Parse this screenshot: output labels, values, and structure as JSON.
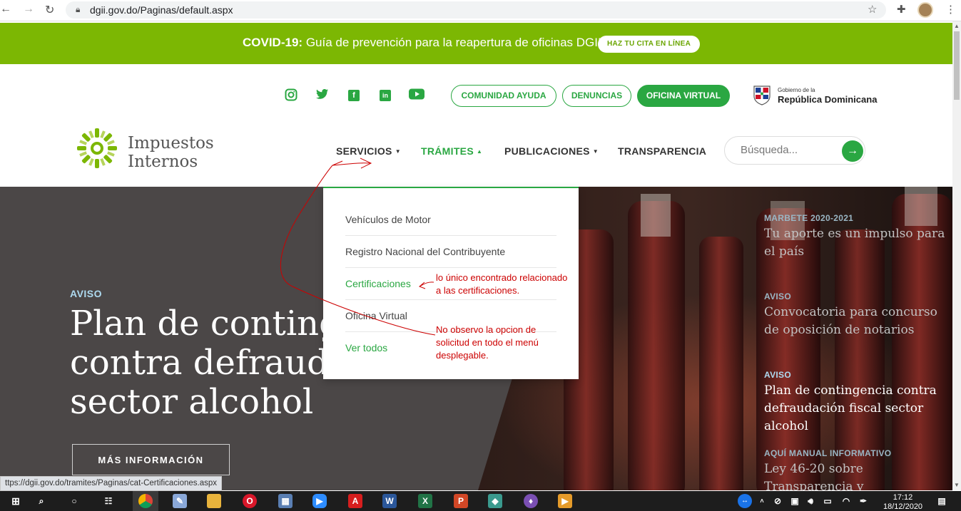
{
  "browser": {
    "url": "dgii.gov.do/Paginas/default.aspx",
    "status_url": "ttps://dgii.gov.do/tramites/Paginas/cat-Certificaciones.aspx"
  },
  "banner": {
    "bold": "COVID-19:",
    "text": "Guía de prevención para la reapertura de oficinas DGII",
    "cta": "HAZ TU CITA EN LÍNEA"
  },
  "social": {
    "icons": [
      "instagram-icon",
      "twitter-icon",
      "facebook-icon",
      "linkedin-icon",
      "youtube-icon"
    ]
  },
  "top_links": {
    "comunidad": "COMUNIDAD AYUDA",
    "denuncias": "DENUNCIAS",
    "oficina": "OFICINA VIRTUAL"
  },
  "gobierno": {
    "small": "Gobierno de la",
    "big": "República Dominicana"
  },
  "logo": {
    "line1": "Impuestos",
    "line2": "Internos"
  },
  "nav": {
    "servicios": "SERVICIOS",
    "tramites": "TRÁMITES",
    "publicaciones": "PUBLICACIONES",
    "transparencia": "TRANSPARENCIA"
  },
  "search": {
    "placeholder": "Búsqueda..."
  },
  "dropdown": {
    "items": [
      "Vehículos de Motor",
      "Registro Nacional del Contribuyente",
      "Certificaciones",
      "Oficina Virtual",
      "Ver todos"
    ]
  },
  "hero": {
    "tag": "AVISO",
    "title": "Plan de contingencia contra defraudación fiscal sector alcohol",
    "button": "MÁS INFORMACIÓN"
  },
  "side_news": [
    {
      "tag": "MARBETE 2020-2021",
      "title": "Tu aporte es un impulso para el país"
    },
    {
      "tag": "AVISO",
      "title": "Convocatoria para concurso de oposición de notarios"
    },
    {
      "tag": "AVISO",
      "title": "Plan de contingencia contra defraudación fiscal sector alcohol"
    },
    {
      "tag": "AQUÍ MANUAL INFORMATIVO",
      "title": "Ley 46-20 sobre Transparencia y"
    }
  ],
  "annotations": {
    "note1": "lo único encontrado relacionado  a las certificaciones.",
    "note2": "No observo la opcion de solicitud en todo el menú desplegable."
  },
  "taskbar": {
    "time": "17:12",
    "date": "18/12/2020"
  },
  "colors": {
    "green": "#2aa742",
    "banner": "#7cb703",
    "annotation": "#cc0000"
  }
}
